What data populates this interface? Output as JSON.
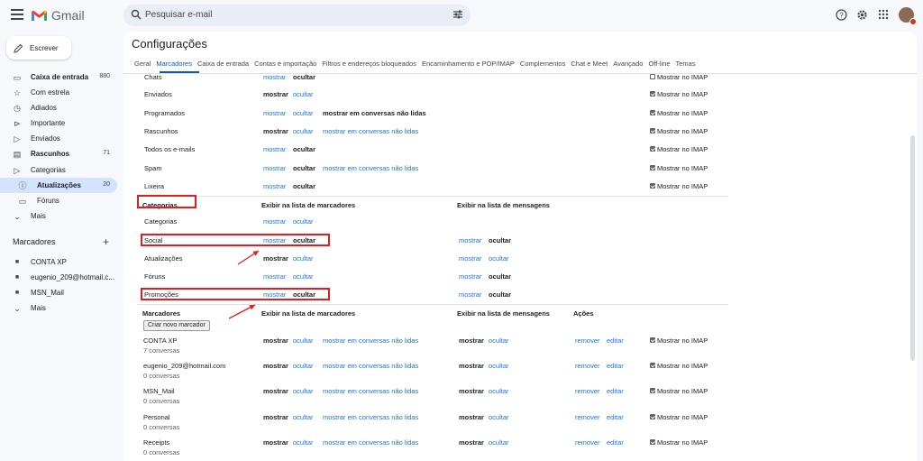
{
  "app": {
    "name": "Gmail",
    "search_placeholder": "Pesquisar e-mail"
  },
  "top_icons": [
    "help-icon",
    "settings-icon",
    "apps-icon"
  ],
  "compose_label": "Escrever",
  "nav": [
    {
      "label": "Caixa de entrada",
      "count": "880",
      "icon": "inbox-icon",
      "bold": true
    },
    {
      "label": "Com estrela",
      "count": "",
      "icon": "star-icon",
      "bold": false
    },
    {
      "label": "Adiados",
      "count": "",
      "icon": "clock-icon",
      "bold": false
    },
    {
      "label": "Importante",
      "count": "",
      "icon": "important-icon",
      "bold": false
    },
    {
      "label": "Enviados",
      "count": "",
      "icon": "send-icon",
      "bold": false
    },
    {
      "label": "Rascunhos",
      "count": "71",
      "icon": "draft-icon",
      "bold": true
    },
    {
      "label": "Categorias",
      "count": "",
      "icon": "label-outline-icon",
      "bold": false
    },
    {
      "label": "Atualizações",
      "count": "20",
      "icon": "info-icon",
      "bold": true,
      "sub": true,
      "active": true
    },
    {
      "label": "Fóruns",
      "count": "",
      "icon": "forum-icon",
      "bold": false,
      "sub": true
    },
    {
      "label": "Mais",
      "count": "",
      "icon": "chevron-down-icon",
      "bold": false
    }
  ],
  "labels_section": {
    "title": "Marcadores",
    "items": [
      "CONTA XP",
      "eugenio_209@hotmail.c...",
      "MSN_Mail",
      "Mais"
    ]
  },
  "page_title": "Configurações",
  "tabs": [
    "Geral",
    "Marcadores",
    "Caixa de entrada",
    "Contas e importação",
    "Filtros e endereços bloqueados",
    "Encaminhamento e POP/IMAP",
    "Complementos",
    "Chat e Meet",
    "Avançado",
    "Off-line",
    "Temas"
  ],
  "active_tab": "Marcadores",
  "system_labels": [
    {
      "name": "Chats",
      "show": "mostrar",
      "hide": "ocultar",
      "bold": "hide",
      "unread": "",
      "imap": false,
      "imap_label": "Mostrar no IMAP"
    },
    {
      "name": "Enviados",
      "show": "mostrar",
      "hide": "ocultar",
      "bold": "show",
      "unread": "",
      "imap": true,
      "imap_label": "Mostrar no IMAP"
    },
    {
      "name": "Programados",
      "show": "mostrar",
      "hide": "ocultar",
      "bold": "unread",
      "unread": "mostrar em conversas não lidas",
      "imap": true,
      "imap_label": "Mostrar no IMAP"
    },
    {
      "name": "Rascunhos",
      "show": "mostrar",
      "hide": "ocultar",
      "bold": "show",
      "unread": "mostrar em conversas não lidas",
      "imap": true,
      "imap_label": "Mostrar no IMAP"
    },
    {
      "name": "Todos os e-mails",
      "show": "mostrar",
      "hide": "ocultar",
      "bold": "hide",
      "unread": "",
      "imap": true,
      "imap_label": "Mostrar no IMAP"
    },
    {
      "name": "Spam",
      "show": "mostrar",
      "hide": "ocultar",
      "bold": "hide",
      "unread": "mostrar em conversas não lidas",
      "imap": true,
      "imap_label": "Mostrar no IMAP"
    },
    {
      "name": "Lixeira",
      "show": "mostrar",
      "hide": "ocultar",
      "bold": "hide",
      "unread": "",
      "imap": true,
      "imap_label": "Mostrar no IMAP"
    }
  ],
  "categories_header": {
    "title": "Categorias",
    "col1": "Exibir na lista de marcadores",
    "col2": "Exibir na lista de mensagens"
  },
  "categories": [
    {
      "name": "Categorias",
      "show": "mostrar",
      "hide": "ocultar",
      "bold": "none",
      "msg": false
    },
    {
      "name": "Social",
      "show": "mostrar",
      "hide": "ocultar",
      "bold": "hide",
      "msg": true,
      "msg_bold": "hide"
    },
    {
      "name": "Atualizações",
      "show": "mostrar",
      "hide": "ocultar",
      "bold": "show",
      "msg": true,
      "msg_bold": "none"
    },
    {
      "name": "Fóruns",
      "show": "mostrar",
      "hide": "ocultar",
      "bold": "none",
      "msg": true,
      "msg_bold": "hide"
    },
    {
      "name": "Promoções",
      "show": "mostrar",
      "hide": "ocultar",
      "bold": "hide",
      "msg": true,
      "msg_bold": "hide"
    }
  ],
  "labels_header": {
    "title": "Marcadores",
    "col1": "Exibir na lista de marcadores",
    "col2": "Exibir na lista de mensagens",
    "col3": "Ações",
    "create_button": "Criar novo marcador"
  },
  "user_labels": [
    {
      "name": "CONTA XP",
      "count": "7 conversas"
    },
    {
      "name": "eugenio_209@hotmail.com",
      "count": "0 conversas"
    },
    {
      "name": "MSN_Mail",
      "count": "0 conversas"
    },
    {
      "name": "Personal",
      "count": "0 conversas"
    },
    {
      "name": "Receipts",
      "count": "0 conversas"
    }
  ],
  "user_label_texts": {
    "show": "mostrar",
    "hide": "ocultar",
    "unread": "mostrar em conversas não lidas",
    "remove": "remover",
    "edit": "editar",
    "imap": "Mostrar no IMAP"
  }
}
